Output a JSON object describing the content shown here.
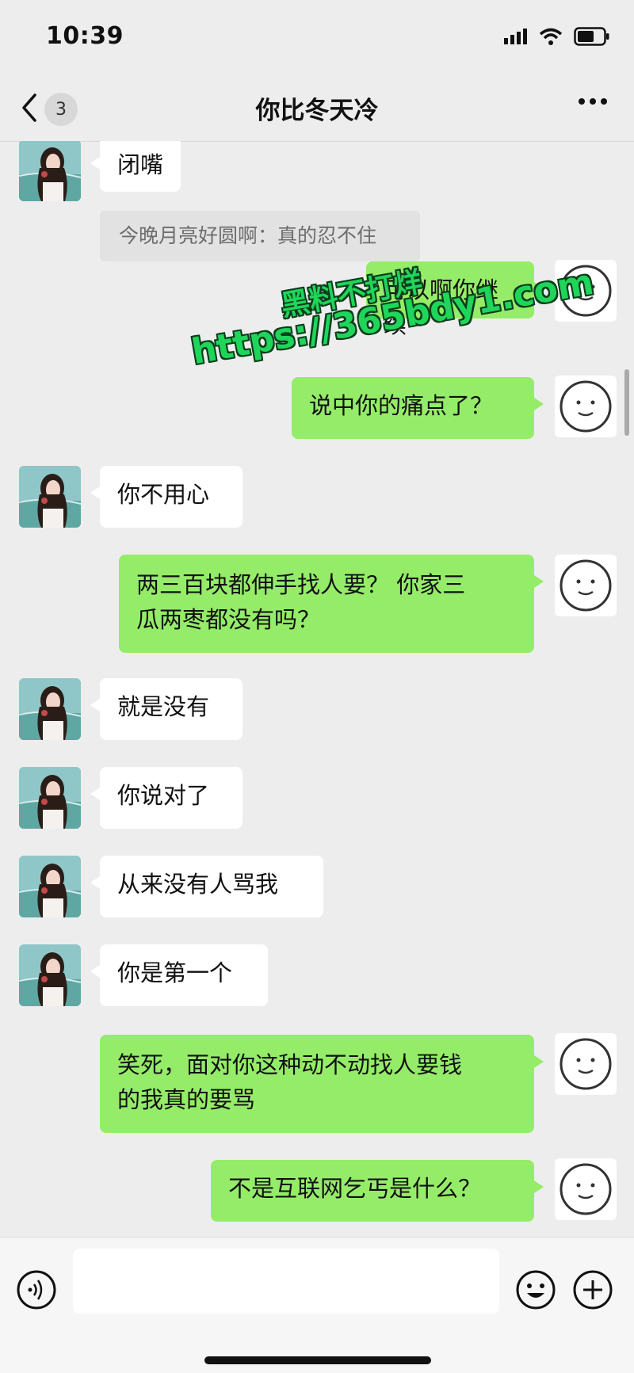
{
  "status_bar": {
    "time": "10:39"
  },
  "nav": {
    "unread_count": "3",
    "title": "你比冬天冷"
  },
  "watermark": {
    "line1": "黑料不打烊",
    "line2": "https://365bdy1.com"
  },
  "messages": [
    {
      "from": "her",
      "text": "闭嘴"
    },
    {
      "from": "quote",
      "text": "今晚月亮好圆啊：真的忍不住"
    },
    {
      "from": "me",
      "text": "可以啊你继续"
    },
    {
      "from": "me",
      "text": "说中你的痛点了？"
    },
    {
      "from": "her",
      "text": "你不用心"
    },
    {
      "from": "me",
      "line1": "两三百块都伸手找人要？ 你家三",
      "line2": "瓜两枣都没有吗？"
    },
    {
      "from": "her",
      "text": "就是没有"
    },
    {
      "from": "her",
      "text": "你说对了"
    },
    {
      "from": "her",
      "text": "从来没有人骂我"
    },
    {
      "from": "her",
      "text": "你是第一个"
    },
    {
      "from": "me",
      "line1": "笑死，面对你这种动不动找人要钱",
      "line2": "的我真的要骂"
    },
    {
      "from": "me",
      "text": "不是互联网乞丐是什么？"
    }
  ],
  "input_bar": {
    "placeholder": ""
  },
  "colors": {
    "background": "#ededed",
    "bubble_out": "#95ec69",
    "bubble_in": "#ffffff",
    "watermark": "#1fd55a"
  },
  "icons": [
    "signal-icon",
    "wifi-icon",
    "battery-icon",
    "back-chevron-icon",
    "more-icon",
    "voice-icon",
    "emoji-icon",
    "plus-icon",
    "avatar-her",
    "avatar-me"
  ]
}
